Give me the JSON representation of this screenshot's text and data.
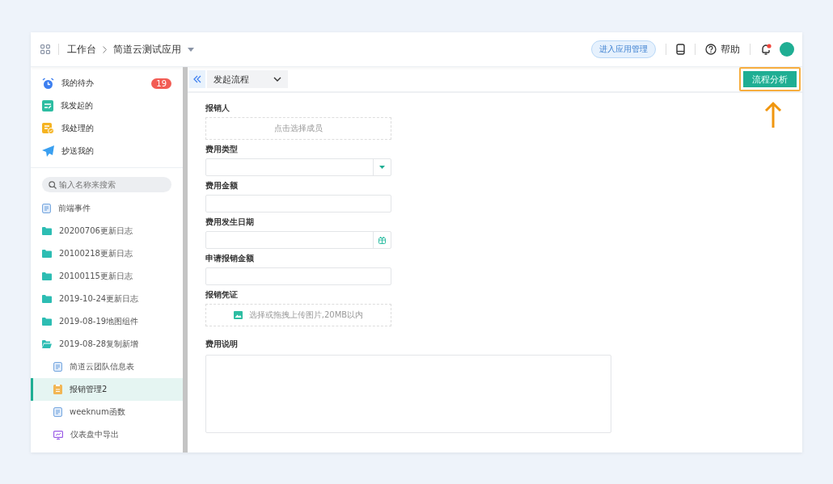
{
  "header": {
    "breadcrumb": [
      "工作台",
      "简道云测试应用"
    ],
    "manage_button": "进入应用管理",
    "help": "帮助",
    "notification_dot": true
  },
  "sidebar": {
    "nav": [
      {
        "kind": "todo",
        "label": "我的待办",
        "badge": "19"
      },
      {
        "kind": "started",
        "label": "我发起的"
      },
      {
        "kind": "handled",
        "label": "我处理的"
      },
      {
        "kind": "cc",
        "label": "抄送我的"
      }
    ],
    "search": {
      "placeholder": "输入名称来搜索"
    },
    "items": [
      {
        "kind": "doc",
        "label": "前端事件",
        "selected": false
      },
      {
        "kind": "folder",
        "label": "20200706更新日志",
        "selected": false
      },
      {
        "kind": "folder",
        "label": "20100218更新日志",
        "selected": false
      },
      {
        "kind": "folder",
        "label": "20100115更新日志",
        "selected": false
      },
      {
        "kind": "folder",
        "label": "2019-10-24更新日志",
        "selected": false
      },
      {
        "kind": "folder",
        "label": "2019-08-19地图组件",
        "selected": false
      },
      {
        "kind": "folder",
        "label": "2019-08-28复制新增",
        "selected": false,
        "expanded": true,
        "children": [
          {
            "kind": "doc",
            "label": "简道云团队信息表",
            "selected": false
          },
          {
            "kind": "form",
            "label": "报销管理2",
            "selected": true
          },
          {
            "kind": "doc",
            "label": "weeknum函数",
            "selected": false
          },
          {
            "kind": "dashboard",
            "label": "仪表盘中导出",
            "selected": false
          }
        ]
      }
    ]
  },
  "toolbar": {
    "process_select": "发起流程",
    "analysis_button": "流程分析",
    "highlighted": true
  },
  "form": {
    "fields": [
      {
        "kind": "member",
        "label": "报销人",
        "placeholder": "点击选择成员"
      },
      {
        "kind": "select",
        "label": "费用类型"
      },
      {
        "kind": "text",
        "label": "费用金额"
      },
      {
        "kind": "date",
        "label": "费用发生日期"
      },
      {
        "kind": "text",
        "label": "申请报销金额"
      },
      {
        "kind": "upload",
        "label": "报销凭证",
        "placeholder": "选择或拖拽上传图片,20MB以内"
      },
      {
        "kind": "textarea",
        "label": "费用说明"
      }
    ]
  }
}
